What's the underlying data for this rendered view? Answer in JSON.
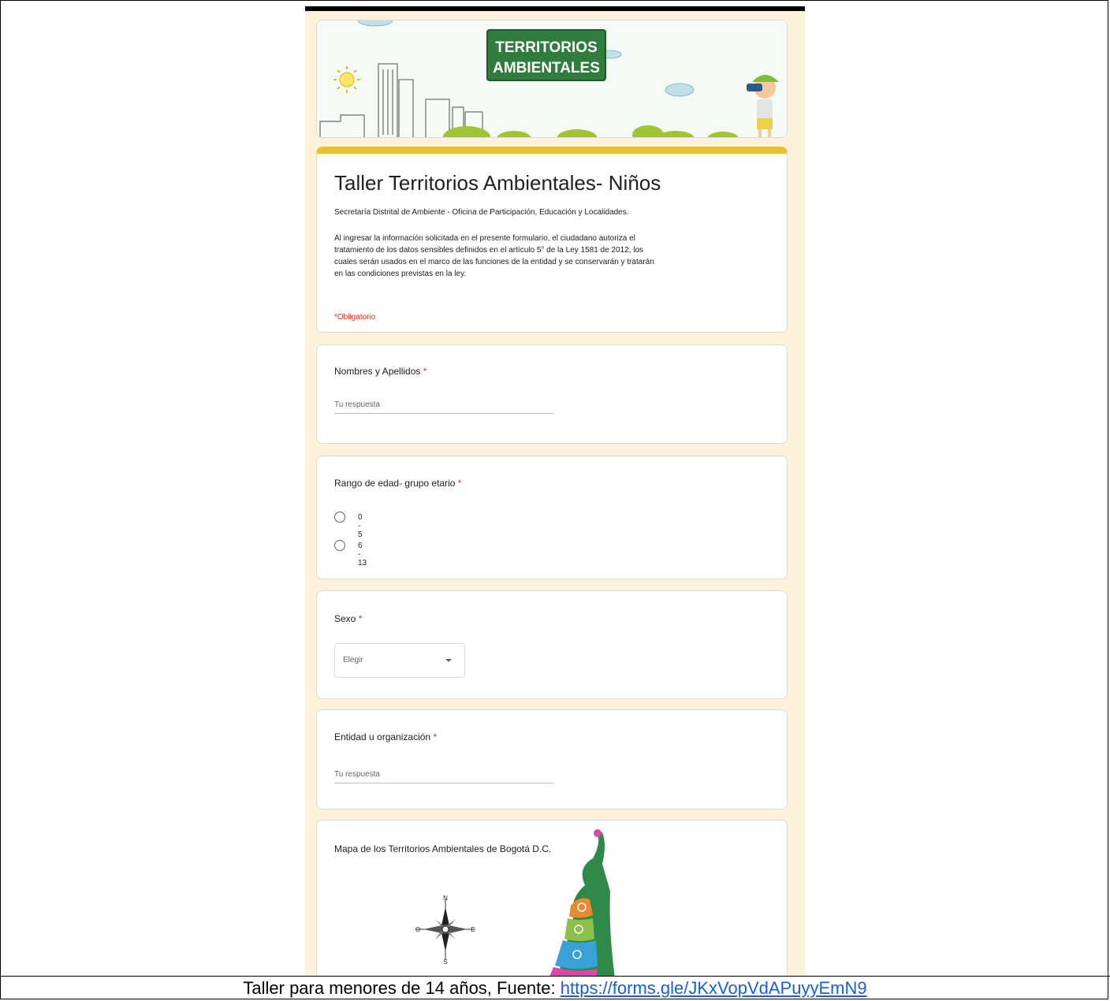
{
  "banner": {
    "logo_line1": "TERRITORIOS",
    "logo_line2": "AMBIENTALES"
  },
  "form": {
    "title": "Taller Territorios Ambientales- Niños",
    "subtitle": "Secretaría Distrital de Ambiente - Oficina de Participación, Educación y Localidades.",
    "privacy_lines": [
      "Al ingresar la información solicitada en el presente formulario, el ciudadano autoriza el",
      "tratamiento de los datos sensibles definidos en el artículo 5° de la Ley 1581 de 2012, los",
      "cuales serán usados en el marco de las funciones de la entidad y se conservarán y tratarán",
      "en las condiciones previstas en la ley."
    ],
    "required_note": "*Obligatorio"
  },
  "questions": {
    "name": {
      "label": "Nombres y Apellidos",
      "required_mark": "*",
      "placeholder": "Tu respuesta"
    },
    "age": {
      "label": "Rango de edad- grupo etario",
      "required_mark": "*",
      "options": [
        "0 - 5",
        "6 - 13"
      ]
    },
    "sex": {
      "label": "Sexo",
      "required_mark": "*",
      "dropdown_value": "Elegir"
    },
    "entity": {
      "label": "Entidad u organización",
      "required_mark": "*",
      "placeholder": "Tu respuesta"
    },
    "map": {
      "label": "Mapa de los Territorios Ambientales de Bogotá D.C.",
      "compass": {
        "n": "N",
        "s": "S",
        "e": "E",
        "o": "O"
      }
    }
  },
  "caption": {
    "text": "Taller para menores de 14 años, Fuente: ",
    "link": "https://forms.gle/JKxVopVdAPuyyEmN9"
  }
}
